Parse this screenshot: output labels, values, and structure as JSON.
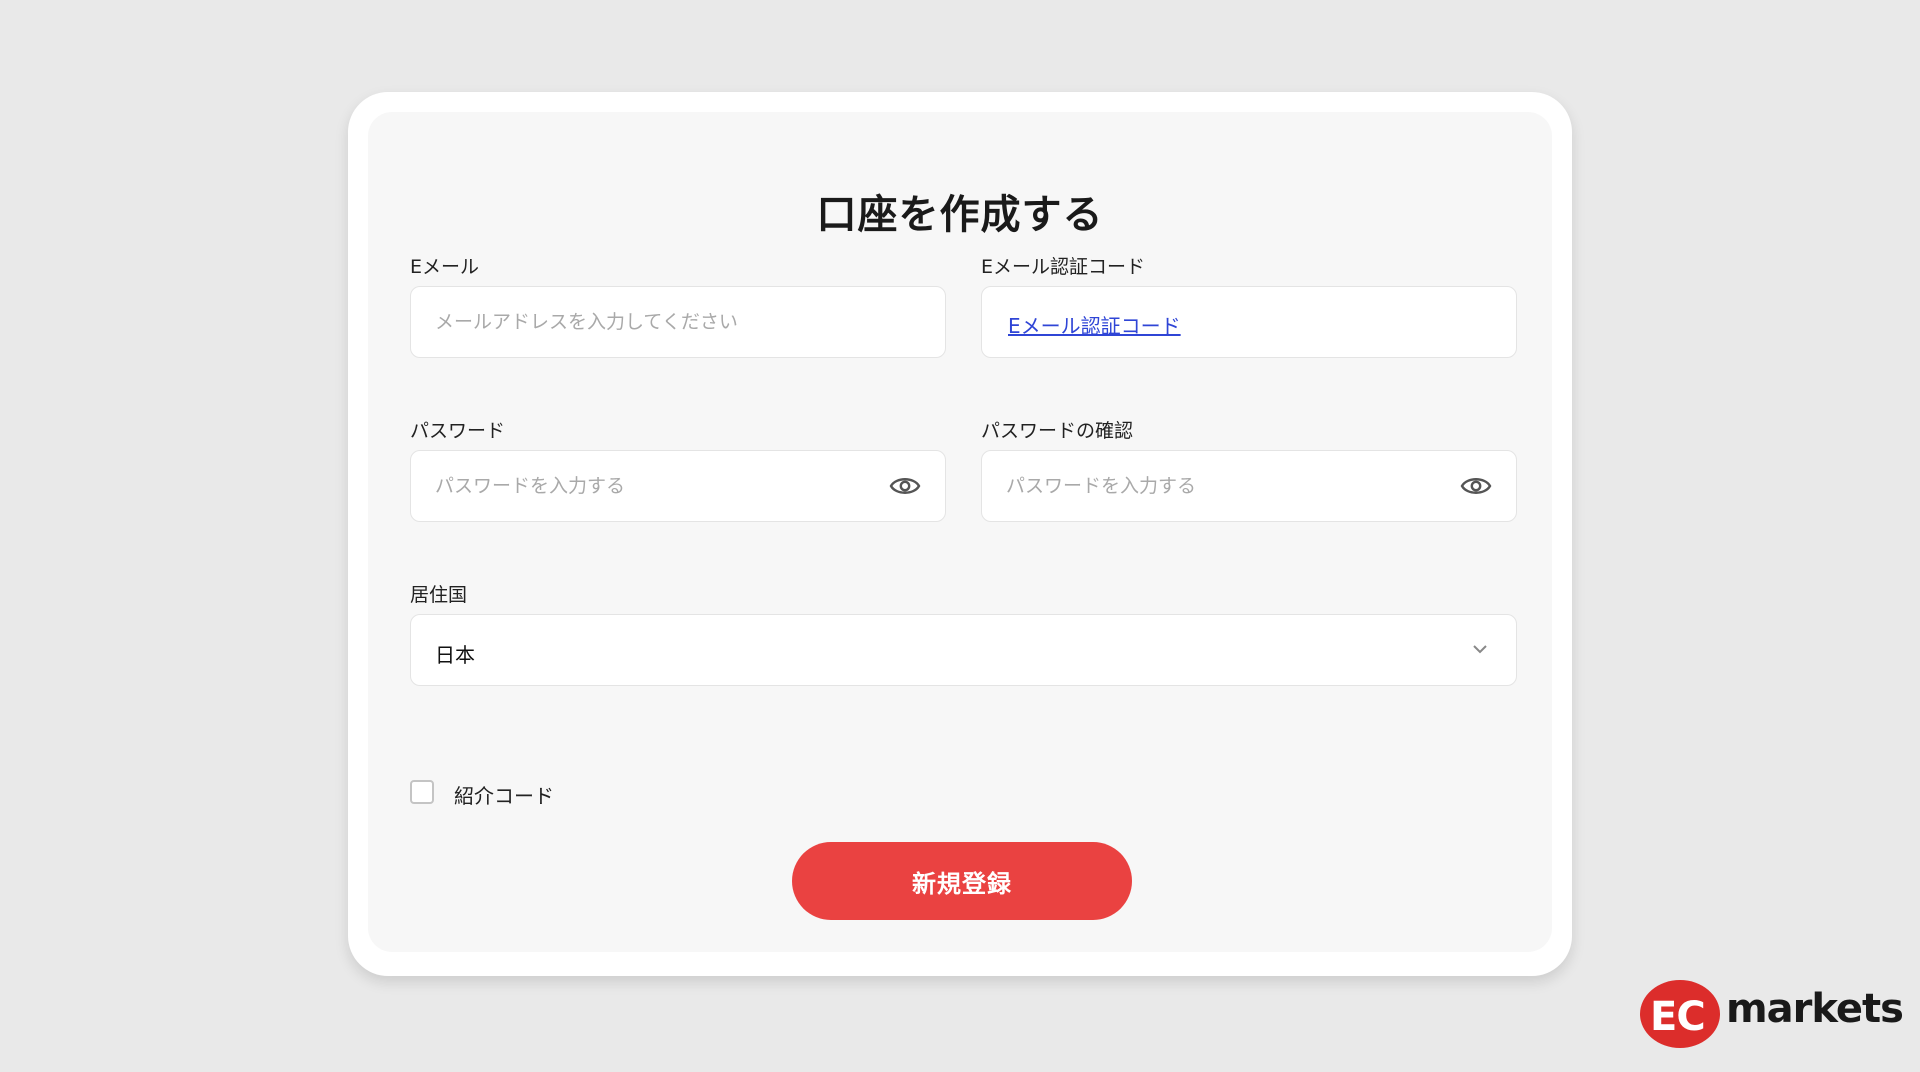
{
  "form": {
    "title": "口座を作成する",
    "email": {
      "label": "Eメール",
      "placeholder": "メールアドレスを入力してください",
      "value": ""
    },
    "email_code": {
      "label": "Eメール認証コード",
      "link_text": "Eメール認証コード"
    },
    "password": {
      "label": "パスワード",
      "placeholder": "パスワードを入力する",
      "value": ""
    },
    "password_confirm": {
      "label": "パスワードの確認",
      "placeholder": "パスワードを入力する",
      "value": ""
    },
    "country": {
      "label": "居住国",
      "selected": "日本"
    },
    "referral": {
      "label": "紹介コード",
      "checked": false
    },
    "submit_label": "新規登録"
  },
  "brand": {
    "logo_mark": "EC",
    "logo_text": "markets",
    "accent_color": "#ea4241"
  },
  "icons": {
    "eye": "eye-icon",
    "chevron": "chevron-down-icon"
  }
}
